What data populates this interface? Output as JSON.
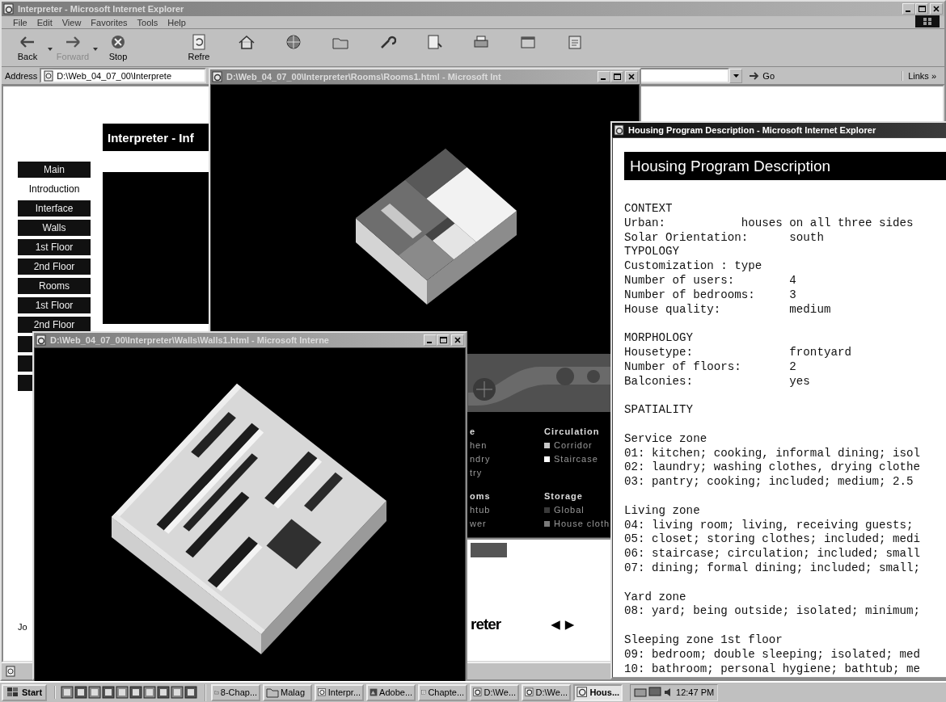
{
  "main_window": {
    "title": "Interpreter - Microsoft Internet Explorer",
    "active": false,
    "menu": [
      "File",
      "Edit",
      "View",
      "Favorites",
      "Tools",
      "Help"
    ],
    "toolbar": [
      {
        "label": "Back",
        "kind": "back",
        "disabled": false
      },
      {
        "label": "Forward",
        "kind": "forward",
        "disabled": true
      },
      {
        "label": "Stop",
        "kind": "stop",
        "disabled": false
      },
      {
        "label": "Refre",
        "kind": "refresh",
        "disabled": false
      }
    ],
    "address": {
      "label": "Address",
      "value": "D:\\Web_04_07_00\\Interprete"
    },
    "go": "Go",
    "links": "Links »",
    "page_heading": "Interpreter - Inf",
    "nav": [
      {
        "label": "Main",
        "selected": false
      },
      {
        "label": "Introduction",
        "selected": true
      },
      {
        "label": "Interface",
        "selected": false
      },
      {
        "label": "Walls",
        "selected": false
      },
      {
        "label": "1st Floor",
        "selected": false
      },
      {
        "label": "2nd Floor",
        "selected": false
      },
      {
        "label": "Rooms",
        "selected": false
      },
      {
        "label": "1st Floor",
        "selected": false
      },
      {
        "label": "2nd Floor",
        "selected": false
      }
    ],
    "footer_text": "Jo",
    "bottom_title": "reter",
    "nav_arrows": [
      "◀",
      "▶"
    ]
  },
  "rooms_window": {
    "title": "D:\\Web_04_07_00\\Interpreter\\Rooms\\Rooms1.html - Microsoft Int",
    "active": false,
    "legend": [
      {
        "heading": "e",
        "items": [
          {
            "label": "hen"
          },
          {
            "label": "ndry"
          },
          {
            "label": "try"
          }
        ]
      },
      {
        "heading": "Circulation",
        "items": [
          {
            "label": "Corridor",
            "color": "#c8c8c8"
          },
          {
            "label": "Staircase",
            "color": "#ffffff"
          }
        ]
      },
      {
        "heading": "oms",
        "items": [
          {
            "label": "htub"
          },
          {
            "label": "wer"
          }
        ]
      },
      {
        "heading": "Storage",
        "items": [
          {
            "label": "Global",
            "color": "#3a3a3a"
          },
          {
            "label": "House cloth",
            "color": "#7a7a7a"
          }
        ]
      }
    ]
  },
  "walls_window": {
    "title": "D:\\Web_04_07_00\\Interpreter\\Walls\\Walls1.html - Microsoft Interne",
    "active": false
  },
  "housing_window": {
    "title": "Housing Program Description - Microsoft Internet Explorer",
    "active": true,
    "heading": "Housing Program Description",
    "sections": [
      {
        "lines": [
          "CONTEXT",
          "Urban:           houses on all three sides",
          "Solar Orientation:      south",
          "TYPOLOGY",
          "Customization : type",
          "Number of users:        4",
          "Number of bedrooms:     3",
          "House quality:          medium"
        ]
      },
      {
        "lines": [
          "MORPHOLOGY",
          "Housetype:              frontyard",
          "Number of floors:       2",
          "Balconies:              yes"
        ]
      },
      {
        "lines": [
          "SPATIALITY"
        ]
      },
      {
        "lines": [
          "Service zone",
          "01: kitchen; cooking, informal dining; isol",
          "02: laundry; washing clothes, drying clothe",
          "03: pantry; cooking; included; medium; 2.5"
        ]
      },
      {
        "lines": [
          "Living zone",
          "04: living room; living, receiving guests;",
          "05: closet; storing clothes; included; medi",
          "06: staircase; circulation; included; small",
          "07: dining; formal dining; included; small;"
        ]
      },
      {
        "lines": [
          "Yard zone",
          "08: yard; being outside; isolated; minimum;"
        ]
      },
      {
        "lines": [
          "Sleeping zone 1st floor",
          "09: bedroom; double sleeping; isolated; med",
          "10: bathroom; personal hygiene; bathtub; me"
        ]
      }
    ]
  },
  "taskbar": {
    "start": "Start",
    "tasks": [
      {
        "label": "8-Chap...",
        "kind": "folder",
        "selected": false
      },
      {
        "label": "Malag",
        "kind": "folder",
        "selected": false
      },
      {
        "label": "Interpr...",
        "kind": "browser",
        "selected": false
      },
      {
        "label": "Adobe...",
        "kind": "graphics",
        "selected": false
      },
      {
        "label": "Chapte...",
        "kind": "document",
        "selected": false
      },
      {
        "label": "D:\\We...",
        "kind": "browser",
        "selected": false
      },
      {
        "label": "D:\\We...",
        "kind": "browser",
        "selected": false
      },
      {
        "label": "Hous...",
        "kind": "browser",
        "selected": true
      }
    ],
    "clock": "12:47 PM"
  }
}
